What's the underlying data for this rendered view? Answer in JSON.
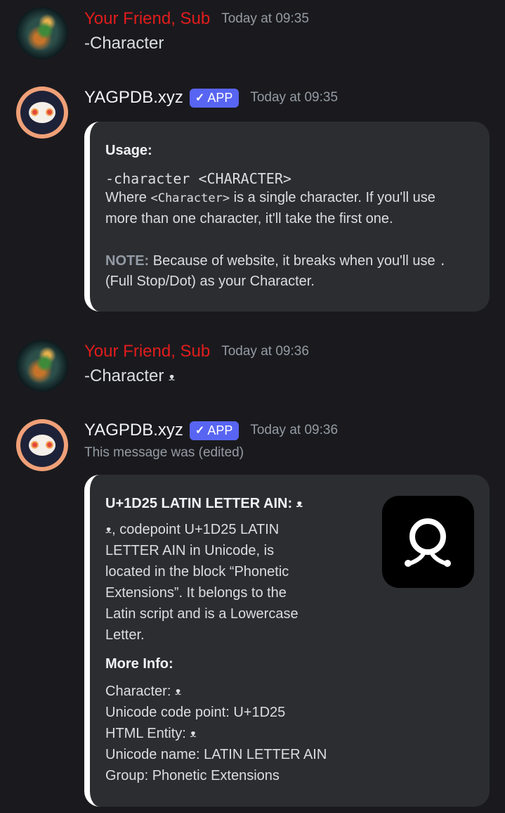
{
  "messages": [
    {
      "author": "Your Friend, Sub",
      "timestamp": "Today at 09:35",
      "content": "-Character"
    },
    {
      "author": "YAGPDB.xyz",
      "badge": "APP",
      "timestamp": "Today at 09:35",
      "embed": {
        "title": "Usage:",
        "code": "-character <CHARACTER>",
        "line2_a": "Where ",
        "line2_code": "<Character>",
        "line2_b": " is a single character. If you'll use",
        "line3": "more than one character, it'll take the first one.",
        "note_label": "NOTE:",
        "note_line1": " Because of website, it breaks when you'll use ",
        "note_dot": ".",
        "note_line2": "(Full Stop/Dot) as your Character."
      }
    },
    {
      "author": "Your Friend, Sub",
      "timestamp": "Today at 09:36",
      "content": "-Character",
      "glyph": "ᴥ"
    },
    {
      "author": "YAGPDB.xyz",
      "badge": "APP",
      "timestamp": "Today at 09:36",
      "edited_text": "This message was (edited)",
      "embed": {
        "title": "U+1D25 LATIN LETTER AIN:",
        "glyph": "ᴥ",
        "desc_lines": [
          ", codepoint U+1D25 LATIN",
          "LETTER AIN in Unicode, is",
          "located in the block “Phonetic",
          "Extensions”. It belongs to the",
          "Latin script and is a Lowercase",
          "Letter."
        ],
        "more_info_title": "More Info:",
        "info": {
          "character_label": "Character:",
          "codepoint": "Unicode code point: U+1D25",
          "html_entity_label": "HTML Entity:",
          "name": "Unicode name: LATIN LETTER AIN",
          "group": "Group: Phonetic Extensions"
        }
      }
    }
  ]
}
